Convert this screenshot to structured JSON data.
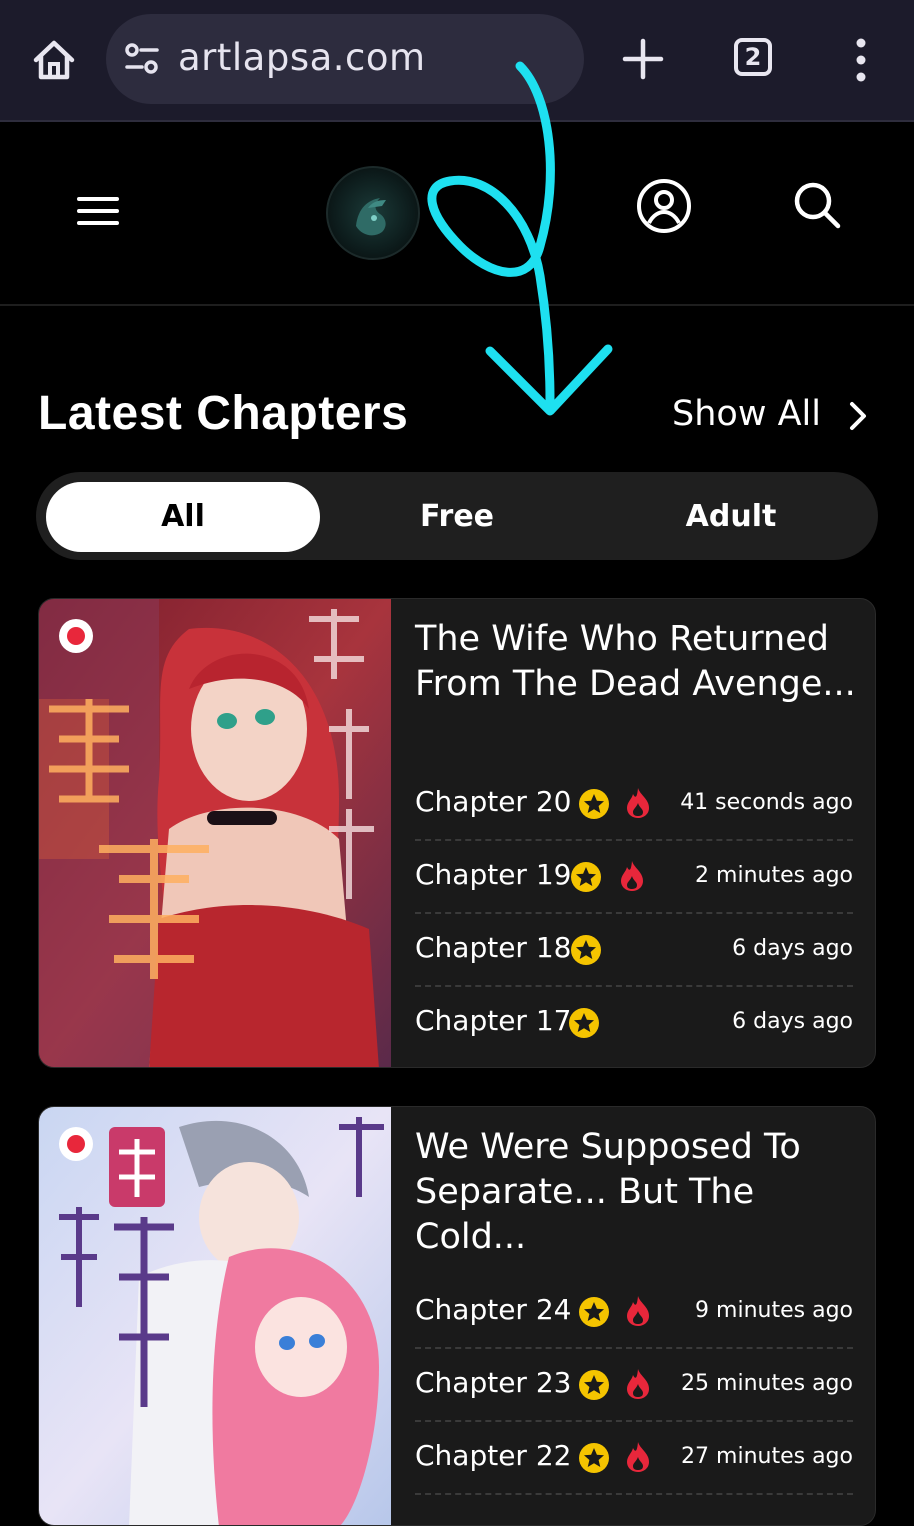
{
  "browser": {
    "url": "artlapsa.com",
    "tab_count": "2"
  },
  "section": {
    "title": "Latest Chapters",
    "show_all": "Show All"
  },
  "filters": [
    {
      "label": "All",
      "active": true
    },
    {
      "label": "Free",
      "active": false
    },
    {
      "label": "Adult",
      "active": false
    }
  ],
  "series": [
    {
      "title": "The Wife Who Returned From The Dead Avenge...",
      "chapters": [
        {
          "label": "Chapter 20",
          "time": "41 seconds ago",
          "star": true,
          "hot": true
        },
        {
          "label": "Chapter 19",
          "time": "2 minutes ago",
          "star": true,
          "hot": true
        },
        {
          "label": "Chapter 18",
          "time": "6 days ago",
          "star": true,
          "hot": false
        },
        {
          "label": "Chapter 17",
          "time": "6 days ago",
          "star": true,
          "hot": false
        }
      ]
    },
    {
      "title": "We Were Supposed To Separate... But The Cold...",
      "chapters": [
        {
          "label": "Chapter 24",
          "time": "9 minutes ago",
          "star": true,
          "hot": true
        },
        {
          "label": "Chapter 23",
          "time": "25 minutes ago",
          "star": true,
          "hot": true
        },
        {
          "label": "Chapter 22",
          "time": "27 minutes ago",
          "star": true,
          "hot": true
        }
      ]
    }
  ],
  "colors": {
    "star": "#f5c400",
    "fire": "#e8273b",
    "annotation": "#1ee0f0"
  },
  "icons": [
    "home-icon",
    "site-info-icon",
    "plus-icon",
    "tabs-icon",
    "more-vert-icon",
    "hamburger-icon",
    "account-icon",
    "search-icon",
    "chevron-right-icon",
    "star-icon",
    "fire-icon"
  ]
}
